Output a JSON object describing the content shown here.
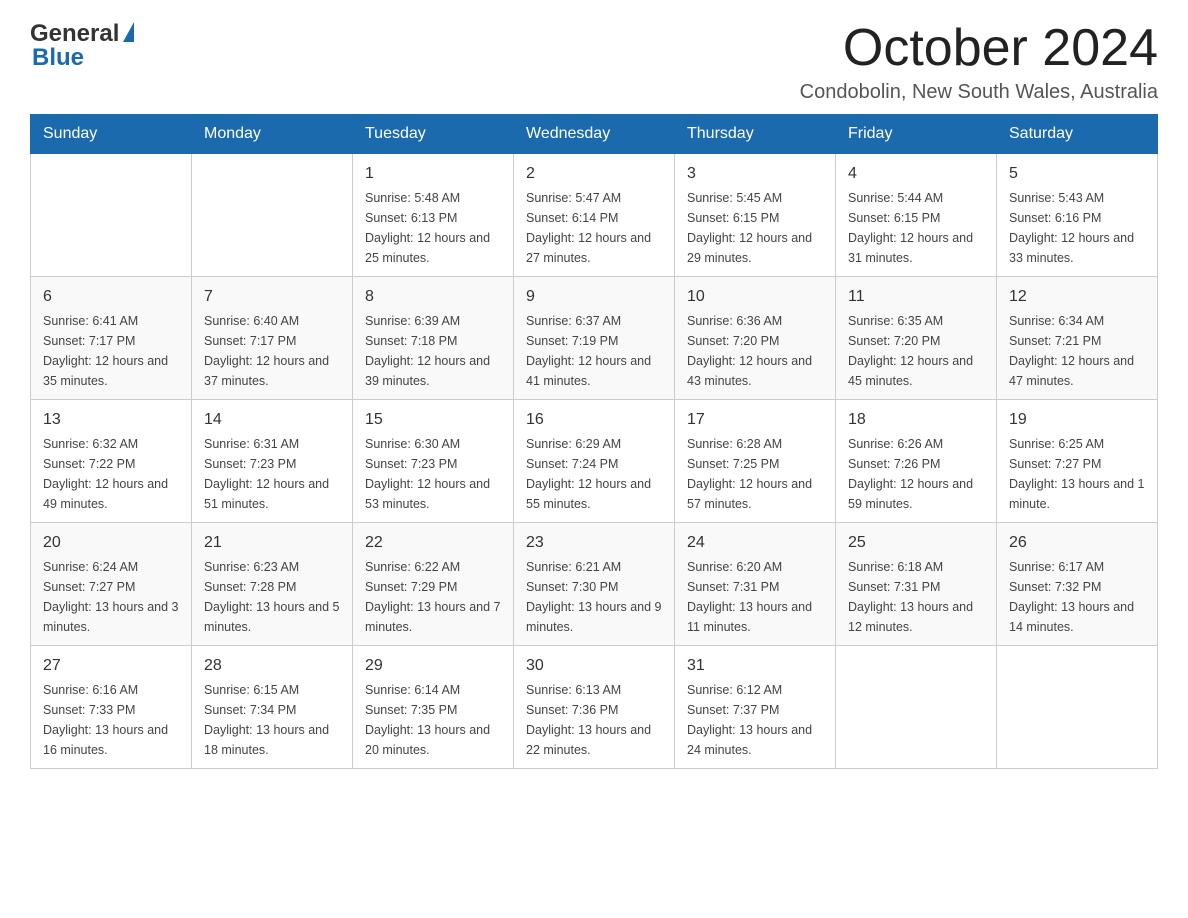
{
  "header": {
    "logo_general": "General",
    "logo_blue": "Blue",
    "month_year": "October 2024",
    "location": "Condobolin, New South Wales, Australia"
  },
  "days_of_week": [
    "Sunday",
    "Monday",
    "Tuesday",
    "Wednesday",
    "Thursday",
    "Friday",
    "Saturday"
  ],
  "weeks": [
    [
      {
        "day": "",
        "sunrise": "",
        "sunset": "",
        "daylight": ""
      },
      {
        "day": "",
        "sunrise": "",
        "sunset": "",
        "daylight": ""
      },
      {
        "day": "1",
        "sunrise": "Sunrise: 5:48 AM",
        "sunset": "Sunset: 6:13 PM",
        "daylight": "Daylight: 12 hours and 25 minutes."
      },
      {
        "day": "2",
        "sunrise": "Sunrise: 5:47 AM",
        "sunset": "Sunset: 6:14 PM",
        "daylight": "Daylight: 12 hours and 27 minutes."
      },
      {
        "day": "3",
        "sunrise": "Sunrise: 5:45 AM",
        "sunset": "Sunset: 6:15 PM",
        "daylight": "Daylight: 12 hours and 29 minutes."
      },
      {
        "day": "4",
        "sunrise": "Sunrise: 5:44 AM",
        "sunset": "Sunset: 6:15 PM",
        "daylight": "Daylight: 12 hours and 31 minutes."
      },
      {
        "day": "5",
        "sunrise": "Sunrise: 5:43 AM",
        "sunset": "Sunset: 6:16 PM",
        "daylight": "Daylight: 12 hours and 33 minutes."
      }
    ],
    [
      {
        "day": "6",
        "sunrise": "Sunrise: 6:41 AM",
        "sunset": "Sunset: 7:17 PM",
        "daylight": "Daylight: 12 hours and 35 minutes."
      },
      {
        "day": "7",
        "sunrise": "Sunrise: 6:40 AM",
        "sunset": "Sunset: 7:17 PM",
        "daylight": "Daylight: 12 hours and 37 minutes."
      },
      {
        "day": "8",
        "sunrise": "Sunrise: 6:39 AM",
        "sunset": "Sunset: 7:18 PM",
        "daylight": "Daylight: 12 hours and 39 minutes."
      },
      {
        "day": "9",
        "sunrise": "Sunrise: 6:37 AM",
        "sunset": "Sunset: 7:19 PM",
        "daylight": "Daylight: 12 hours and 41 minutes."
      },
      {
        "day": "10",
        "sunrise": "Sunrise: 6:36 AM",
        "sunset": "Sunset: 7:20 PM",
        "daylight": "Daylight: 12 hours and 43 minutes."
      },
      {
        "day": "11",
        "sunrise": "Sunrise: 6:35 AM",
        "sunset": "Sunset: 7:20 PM",
        "daylight": "Daylight: 12 hours and 45 minutes."
      },
      {
        "day": "12",
        "sunrise": "Sunrise: 6:34 AM",
        "sunset": "Sunset: 7:21 PM",
        "daylight": "Daylight: 12 hours and 47 minutes."
      }
    ],
    [
      {
        "day": "13",
        "sunrise": "Sunrise: 6:32 AM",
        "sunset": "Sunset: 7:22 PM",
        "daylight": "Daylight: 12 hours and 49 minutes."
      },
      {
        "day": "14",
        "sunrise": "Sunrise: 6:31 AM",
        "sunset": "Sunset: 7:23 PM",
        "daylight": "Daylight: 12 hours and 51 minutes."
      },
      {
        "day": "15",
        "sunrise": "Sunrise: 6:30 AM",
        "sunset": "Sunset: 7:23 PM",
        "daylight": "Daylight: 12 hours and 53 minutes."
      },
      {
        "day": "16",
        "sunrise": "Sunrise: 6:29 AM",
        "sunset": "Sunset: 7:24 PM",
        "daylight": "Daylight: 12 hours and 55 minutes."
      },
      {
        "day": "17",
        "sunrise": "Sunrise: 6:28 AM",
        "sunset": "Sunset: 7:25 PM",
        "daylight": "Daylight: 12 hours and 57 minutes."
      },
      {
        "day": "18",
        "sunrise": "Sunrise: 6:26 AM",
        "sunset": "Sunset: 7:26 PM",
        "daylight": "Daylight: 12 hours and 59 minutes."
      },
      {
        "day": "19",
        "sunrise": "Sunrise: 6:25 AM",
        "sunset": "Sunset: 7:27 PM",
        "daylight": "Daylight: 13 hours and 1 minute."
      }
    ],
    [
      {
        "day": "20",
        "sunrise": "Sunrise: 6:24 AM",
        "sunset": "Sunset: 7:27 PM",
        "daylight": "Daylight: 13 hours and 3 minutes."
      },
      {
        "day": "21",
        "sunrise": "Sunrise: 6:23 AM",
        "sunset": "Sunset: 7:28 PM",
        "daylight": "Daylight: 13 hours and 5 minutes."
      },
      {
        "day": "22",
        "sunrise": "Sunrise: 6:22 AM",
        "sunset": "Sunset: 7:29 PM",
        "daylight": "Daylight: 13 hours and 7 minutes."
      },
      {
        "day": "23",
        "sunrise": "Sunrise: 6:21 AM",
        "sunset": "Sunset: 7:30 PM",
        "daylight": "Daylight: 13 hours and 9 minutes."
      },
      {
        "day": "24",
        "sunrise": "Sunrise: 6:20 AM",
        "sunset": "Sunset: 7:31 PM",
        "daylight": "Daylight: 13 hours and 11 minutes."
      },
      {
        "day": "25",
        "sunrise": "Sunrise: 6:18 AM",
        "sunset": "Sunset: 7:31 PM",
        "daylight": "Daylight: 13 hours and 12 minutes."
      },
      {
        "day": "26",
        "sunrise": "Sunrise: 6:17 AM",
        "sunset": "Sunset: 7:32 PM",
        "daylight": "Daylight: 13 hours and 14 minutes."
      }
    ],
    [
      {
        "day": "27",
        "sunrise": "Sunrise: 6:16 AM",
        "sunset": "Sunset: 7:33 PM",
        "daylight": "Daylight: 13 hours and 16 minutes."
      },
      {
        "day": "28",
        "sunrise": "Sunrise: 6:15 AM",
        "sunset": "Sunset: 7:34 PM",
        "daylight": "Daylight: 13 hours and 18 minutes."
      },
      {
        "day": "29",
        "sunrise": "Sunrise: 6:14 AM",
        "sunset": "Sunset: 7:35 PM",
        "daylight": "Daylight: 13 hours and 20 minutes."
      },
      {
        "day": "30",
        "sunrise": "Sunrise: 6:13 AM",
        "sunset": "Sunset: 7:36 PM",
        "daylight": "Daylight: 13 hours and 22 minutes."
      },
      {
        "day": "31",
        "sunrise": "Sunrise: 6:12 AM",
        "sunset": "Sunset: 7:37 PM",
        "daylight": "Daylight: 13 hours and 24 minutes."
      },
      {
        "day": "",
        "sunrise": "",
        "sunset": "",
        "daylight": ""
      },
      {
        "day": "",
        "sunrise": "",
        "sunset": "",
        "daylight": ""
      }
    ]
  ]
}
